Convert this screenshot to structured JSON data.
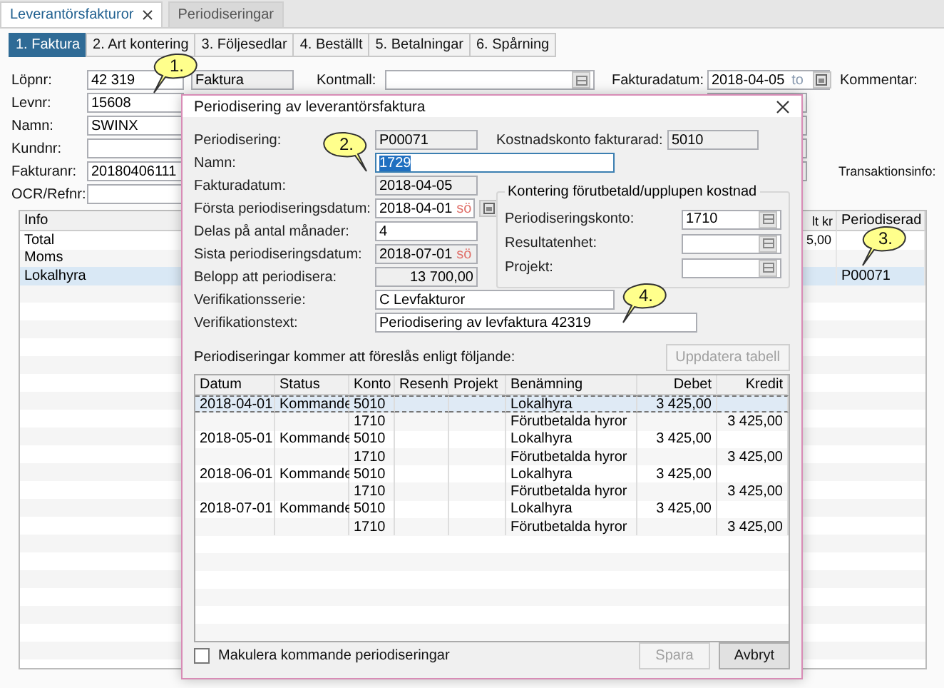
{
  "document_tabs": [
    {
      "label": "Leverantörsfakturor",
      "selected": true,
      "closable": true
    },
    {
      "label": "Periodiseringar",
      "selected": false,
      "closable": false
    }
  ],
  "section_tabs": [
    {
      "label": "1. Faktura",
      "selected": true
    },
    {
      "label": "2. Art kontering",
      "selected": false
    },
    {
      "label": "3. Följesedlar",
      "selected": false
    },
    {
      "label": "4. Beställt",
      "selected": false
    },
    {
      "label": "5. Betalningar",
      "selected": false
    },
    {
      "label": "6. Spårning",
      "selected": false
    }
  ],
  "invoice_form": {
    "fields": [
      {
        "label": "Löpnr:",
        "value": "42 319"
      },
      {
        "label": "Levnr:",
        "value": "15608"
      },
      {
        "label": "Namn:",
        "value": "SWINX"
      },
      {
        "label": "Kundnr:"
      },
      {
        "label": "Fakturanr:",
        "value": "20180406111"
      },
      {
        "label": "OCR/Refnr:"
      }
    ],
    "type_field": {
      "value": "Faktura"
    },
    "kontmall": {
      "label": "Kontmall:"
    },
    "fakturadatum": {
      "label": "Fakturadatum:",
      "value": "2018-04-05",
      "suffix": "to"
    },
    "kommentar_label": "Kommentar:",
    "transaktionsinfo_label": "Transaktionsinfo:"
  },
  "invoice_table": {
    "columns": [
      "Info",
      "lt kr",
      "Periodiserad"
    ],
    "rows": [
      {
        "info": "Total",
        "amount": "5,00",
        "selected": false
      },
      {
        "info": "Moms",
        "selected": false
      },
      {
        "info": "Lokalhyra",
        "periodiserad": "P00071",
        "selected": true
      }
    ]
  },
  "dialog": {
    "title": "Periodisering av leverantörsfaktura",
    "fields": [
      {
        "label": "Periodisering:",
        "value": "P00071",
        "kind": "readonly"
      },
      {
        "label": "Namn:",
        "value": "1729",
        "kind": "wide_input",
        "focused": true
      },
      {
        "label": "Fakturadatum:",
        "value": "2018-04-05",
        "kind": "readonly"
      },
      {
        "label": "Första periodiseringsdatum:",
        "value": "2018-04-01",
        "kind": "date",
        "suffix": "sö"
      },
      {
        "label": "Delas på antal månader:",
        "value": "4",
        "kind": "input"
      },
      {
        "label": "Sista periodiseringsdatum:",
        "value": "2018-07-01",
        "kind": "readonly_date",
        "suffix": "sö"
      },
      {
        "label": "Belopp att periodisera:",
        "value": "13 700,00",
        "kind": "amount"
      }
    ],
    "cost_account": {
      "label": "Kostnadskonto fakturarad:",
      "value": "5010"
    },
    "accrual_group": {
      "title": "Kontering förutbetald/upplupen kostnad",
      "fields": [
        {
          "label": "Periodiseringskonto:",
          "value": "1710"
        },
        {
          "label": "Resultatenhet:"
        },
        {
          "label": "Projekt:"
        }
      ]
    },
    "voucher_fields": [
      {
        "label": "Verifikationsserie:",
        "value": "C  Levfakturor",
        "kind": "wide_input"
      },
      {
        "label": "Verifikationstext:",
        "value": "Periodisering av levfaktura 42319",
        "kind": "long_input"
      }
    ],
    "schedule_caption": "Periodiseringar kommer att föreslås enligt följande:",
    "update_button": {
      "label": "Uppdatera tabell",
      "disabled": true
    },
    "schedule": {
      "columns": [
        "Datum",
        "Status",
        "Konto",
        "Resenh",
        "Projekt",
        "Benämning",
        "Debet",
        "Kredit"
      ],
      "rows": [
        {
          "datum": "2018-04-01",
          "status": "Kommande",
          "konto": "5010",
          "benamning": "Lokalhyra",
          "debet": "3 425,00",
          "selected": true
        },
        {
          "konto": "1710",
          "benamning": "Förutbetalda hyror",
          "kredit": "3 425,00",
          "selected": false
        },
        {
          "datum": "2018-05-01",
          "status": "Kommande",
          "konto": "5010",
          "benamning": "Lokalhyra",
          "debet": "3 425,00",
          "selected": false
        },
        {
          "konto": "1710",
          "benamning": "Förutbetalda hyror",
          "kredit": "3 425,00",
          "selected": false
        },
        {
          "datum": "2018-06-01",
          "status": "Kommande",
          "konto": "5010",
          "benamning": "Lokalhyra",
          "debet": "3 425,00",
          "selected": false
        },
        {
          "konto": "1710",
          "benamning": "Förutbetalda hyror",
          "kredit": "3 425,00",
          "selected": false
        },
        {
          "datum": "2018-07-01",
          "status": "Kommande",
          "konto": "5010",
          "benamning": "Lokalhyra",
          "debet": "3 425,00",
          "selected": false
        },
        {
          "konto": "1710",
          "benamning": "Förutbetalda hyror",
          "kredit": "3 425,00",
          "selected": false
        }
      ]
    },
    "void_checkbox": {
      "label": "Makulera kommande periodiseringar",
      "checked": false
    },
    "buttons": [
      {
        "label": "Spara",
        "disabled": true
      },
      {
        "label": "Avbryt",
        "disabled": false
      }
    ]
  },
  "callouts": [
    {
      "label": "1."
    },
    {
      "label": "2."
    },
    {
      "label": "3."
    },
    {
      "label": "4."
    }
  ]
}
